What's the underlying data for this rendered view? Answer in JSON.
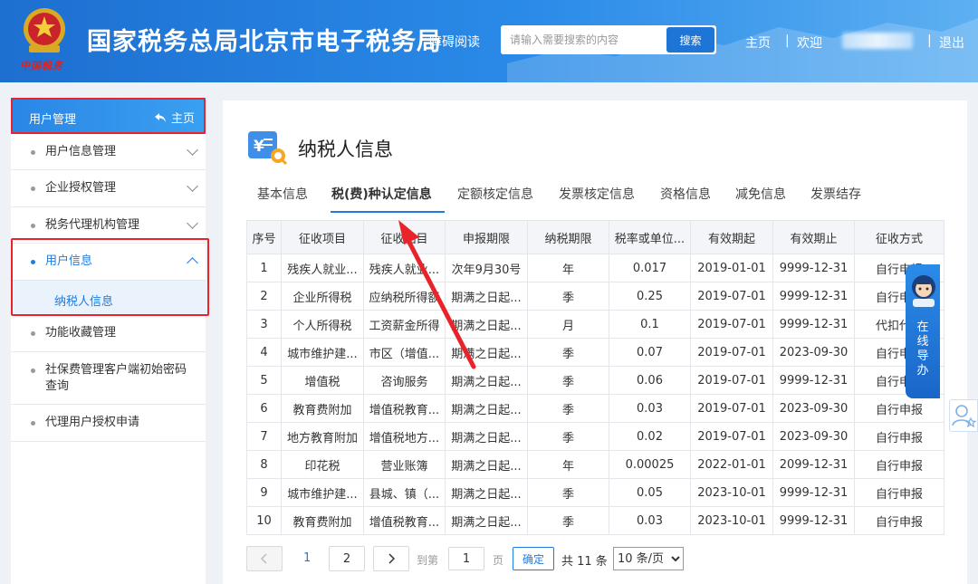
{
  "header": {
    "emblem_text": "中国税务",
    "site_title": "国家税务总局北京市电子税务局",
    "accessible_reading": "障碍阅读",
    "search_placeholder": "请输入需要搜索的内容",
    "search_button": "搜索",
    "nav_home": "主页",
    "nav_separator": "|",
    "nav_welcome": "欢迎",
    "nav_logout": "退出"
  },
  "sidebar": {
    "header_title": "用户管理",
    "header_home": "主页",
    "items": [
      {
        "label": "用户信息管理"
      },
      {
        "label": "企业授权管理"
      },
      {
        "label": "税务代理机构管理"
      },
      {
        "label": "用户信息"
      },
      {
        "label": "功能收藏管理"
      },
      {
        "label": "社保费管理客户端初始密码查询"
      },
      {
        "label": "代理用户授权申请"
      }
    ],
    "sub_item": "纳税人信息"
  },
  "main": {
    "page_title": "纳税人信息",
    "tabs": [
      {
        "label": "基本信息"
      },
      {
        "label": "税(费)种认定信息"
      },
      {
        "label": "定额核定信息"
      },
      {
        "label": "发票核定信息"
      },
      {
        "label": "资格信息"
      },
      {
        "label": "减免信息"
      },
      {
        "label": "发票结存"
      }
    ],
    "table": {
      "headers": [
        "序号",
        "征收项目",
        "征收品目",
        "申报期限",
        "纳税期限",
        "税率或单位...",
        "有效期起",
        "有效期止",
        "征收方式"
      ],
      "rows": [
        [
          "1",
          "残疾人就业...",
          "残疾人就业...",
          "次年9月30号",
          "年",
          "0.017",
          "2019-01-01",
          "9999-12-31",
          "自行申报"
        ],
        [
          "2",
          "企业所得税",
          "应纳税所得额",
          "期满之日起...",
          "季",
          "0.25",
          "2019-07-01",
          "9999-12-31",
          "自行申报"
        ],
        [
          "3",
          "个人所得税",
          "工资薪金所得",
          "期满之日起...",
          "月",
          "0.1",
          "2019-07-01",
          "9999-12-31",
          "代扣代缴"
        ],
        [
          "4",
          "城市维护建...",
          "市区（增值...",
          "期满之日起...",
          "季",
          "0.07",
          "2019-07-01",
          "2023-09-30",
          "自行申报"
        ],
        [
          "5",
          "增值税",
          "咨询服务",
          "期满之日起...",
          "季",
          "0.06",
          "2019-07-01",
          "9999-12-31",
          "自行申报"
        ],
        [
          "6",
          "教育费附加",
          "增值税教育...",
          "期满之日起...",
          "季",
          "0.03",
          "2019-07-01",
          "2023-09-30",
          "自行申报"
        ],
        [
          "7",
          "地方教育附加",
          "增值税地方...",
          "期满之日起...",
          "季",
          "0.02",
          "2019-07-01",
          "2023-09-30",
          "自行申报"
        ],
        [
          "8",
          "印花税",
          "营业账簿",
          "期满之日起...",
          "年",
          "0.00025",
          "2022-01-01",
          "2099-12-31",
          "自行申报"
        ],
        [
          "9",
          "城市维护建...",
          "县城、镇（...",
          "期满之日起...",
          "季",
          "0.05",
          "2023-10-01",
          "9999-12-31",
          "自行申报"
        ],
        [
          "10",
          "教育费附加",
          "增值税教育...",
          "期满之日起...",
          "季",
          "0.03",
          "2023-10-01",
          "9999-12-31",
          "自行申报"
        ]
      ]
    },
    "pager": {
      "page_1": "1",
      "page_2": "2",
      "goto_label": "到第",
      "goto_value": "1",
      "page_unit": "页",
      "confirm": "确定",
      "total": "共 11 条",
      "page_size": "10 条/页"
    }
  },
  "float": {
    "guide_text": "在线导办"
  },
  "colors": {
    "brand_blue": "#1f7bde",
    "header_gradient_start": "#1d6fd0",
    "highlight_red": "#e8242a"
  }
}
